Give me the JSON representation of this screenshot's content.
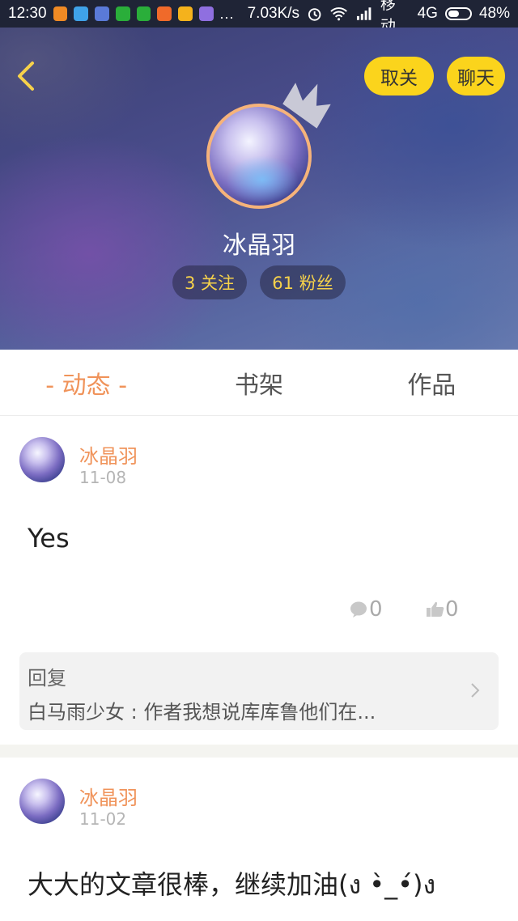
{
  "status_bar": {
    "time": "12:30",
    "dots": "...",
    "speed": "7.03K/s",
    "carrier": "移动",
    "network": "4G",
    "battery": "48%",
    "app_icon_colors": [
      "#f08a24",
      "#3fa2e8",
      "#5a7ad8",
      "#2aae3a",
      "#2aae3a",
      "#f06a2a",
      "#f5b21c",
      "#8f6fe0"
    ]
  },
  "header": {
    "unfollow_label": "取关",
    "chat_label": "聊天",
    "username": "冰晶羽",
    "follow_count": "3 关注",
    "fans_count": "61 粉丝",
    "accent_color": "#fbd41c"
  },
  "tabs": [
    {
      "label": "- 动态 -",
      "active": true
    },
    {
      "label": "书架",
      "active": false
    },
    {
      "label": "作品",
      "active": false
    }
  ],
  "posts": [
    {
      "author": "冰晶羽",
      "date": "11-08",
      "text": "Yes",
      "comments": "0",
      "likes": "0",
      "reply": {
        "title": "回复",
        "text": "白马雨少女 : 作者我想说库库鲁他们在..."
      }
    },
    {
      "author": "冰晶羽",
      "date": "11-02",
      "text": "大大的文章很棒，继续加油(ง •̀_•́)ง"
    }
  ]
}
